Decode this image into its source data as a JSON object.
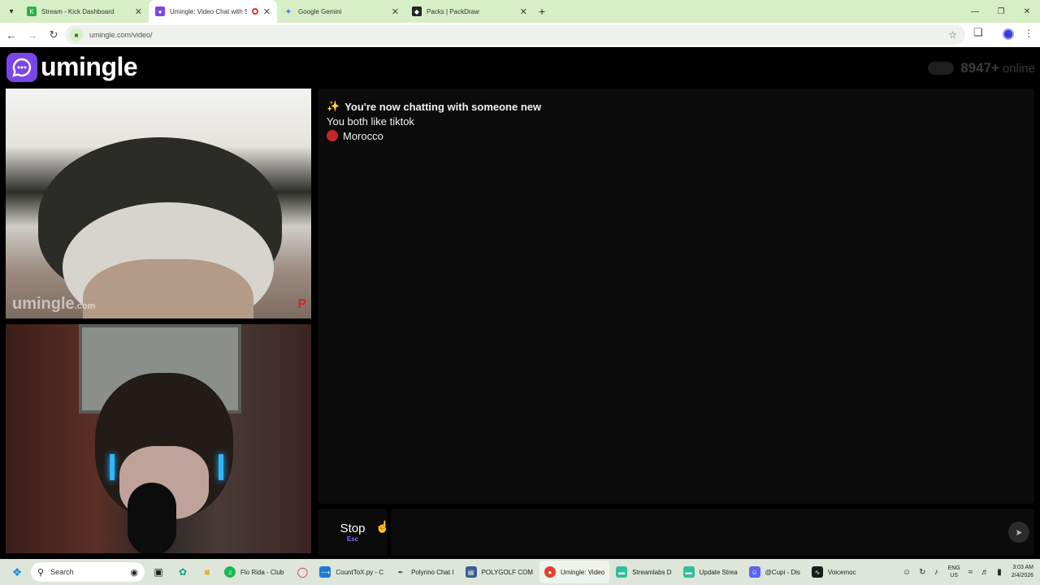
{
  "browser": {
    "tabs": [
      {
        "title": "Stream - Kick Dashboard",
        "favicon": "kick-icon",
        "color": "#2bb24c"
      },
      {
        "title": "Umingle: Video Chat with S",
        "favicon": "umingle-icon",
        "color": "#7b46e8",
        "active": true
      },
      {
        "title": "Google Gemini",
        "favicon": "gemini-icon",
        "color": "#4a86e8"
      },
      {
        "title": "Packs | PackDraw",
        "favicon": "packdraw-icon",
        "color": "#222222"
      }
    ],
    "url": "umingle.com/video/"
  },
  "site": {
    "brand": "umingle",
    "online_count": "8947+",
    "online_label": "online",
    "accent": "#7b46e8"
  },
  "stranger_video": {
    "watermark": "umingle",
    "watermark_suffix": ".com",
    "flag_badge": "P"
  },
  "chat": {
    "intro": "You're now chatting with someone new",
    "interests": "You both like tiktok",
    "country": "Morocco"
  },
  "controls": {
    "stop_label": "Stop",
    "stop_hint": "Esc",
    "send_icon": "send-icon"
  },
  "taskbar": {
    "search_label": "Search",
    "apps": [
      {
        "label": "Flo Rida - Club",
        "icon": "spotify-icon",
        "color": "#1db954"
      },
      {
        "label": "CountToX.py - C",
        "icon": "vscode-icon",
        "color": "#1e7bd4"
      },
      {
        "label": "Polyrino Chat I",
        "icon": "feather-icon",
        "color": "#555555"
      },
      {
        "label": "POLYGOLF COM",
        "icon": "document-icon",
        "color": "#3a5f8f"
      },
      {
        "label": "Umingle: Video",
        "icon": "chrome-icon",
        "color": "#e3402d",
        "active": true
      },
      {
        "label": "Streamlabs D",
        "icon": "streamlabs-icon",
        "color": "#2fbf9b"
      },
      {
        "label": "Update Strea",
        "icon": "streamlabs-icon",
        "color": "#2fbf9b"
      },
      {
        "label": "@Cupi - Dis",
        "icon": "discord-icon",
        "color": "#5865f2"
      },
      {
        "label": "Voicemoc",
        "icon": "voicemod-icon",
        "color": "#1a1a1a"
      }
    ],
    "lang_top": "ENG",
    "lang_bottom": "US",
    "time": "3:03 AM",
    "date": "2/4/2026"
  }
}
